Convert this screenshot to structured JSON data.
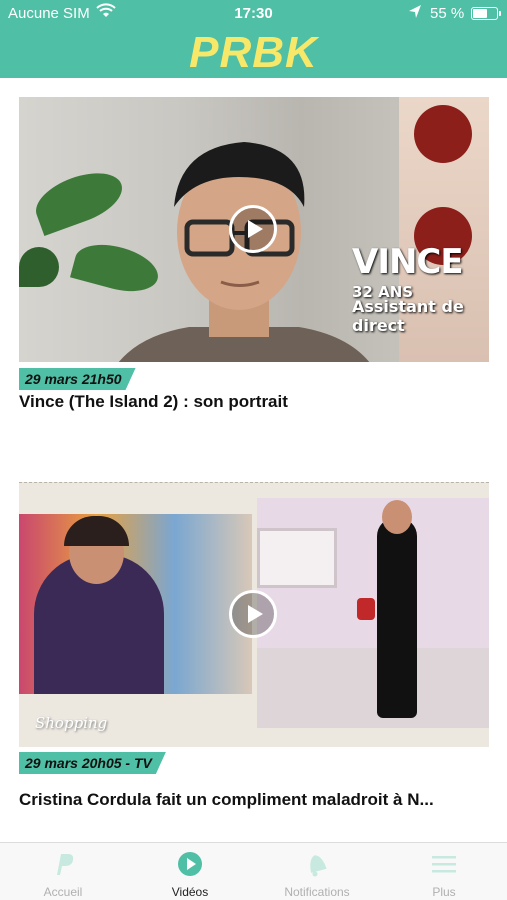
{
  "status_bar": {
    "carrier": "Aucune SIM",
    "time": "17:30",
    "battery": "55 %",
    "battery_level": 0.55
  },
  "header": {
    "logo": "PRBK",
    "colors": {
      "background": "#4fbfa5",
      "logo": "#f7e86a"
    }
  },
  "videos": [
    {
      "date_tag": "29 mars 21h50",
      "title": "Vince (The Island 2) : son portrait",
      "overlay": {
        "name": "VINCE",
        "age": "32 ANS",
        "role": "Assistant de direct"
      },
      "play_icon": "play-icon"
    },
    {
      "date_tag": "29 mars 20h05 - TV",
      "title": "Cristina Cordula fait un compliment maladroit à N...",
      "overlay": {
        "show": "Shopping"
      },
      "play_icon": "play-icon"
    }
  ],
  "tab_bar": {
    "tabs": [
      {
        "label": "Accueil",
        "icon": "prbk-logo-icon",
        "active": false
      },
      {
        "label": "Vidéos",
        "icon": "play-circle-icon",
        "active": true
      },
      {
        "label": "Notifications",
        "icon": "bell-icon",
        "active": false
      },
      {
        "label": "Plus",
        "icon": "menu-icon",
        "active": false
      }
    ],
    "colors": {
      "active_icon": "#4fbfa5",
      "inactive_icon": "#c8e9df"
    }
  }
}
